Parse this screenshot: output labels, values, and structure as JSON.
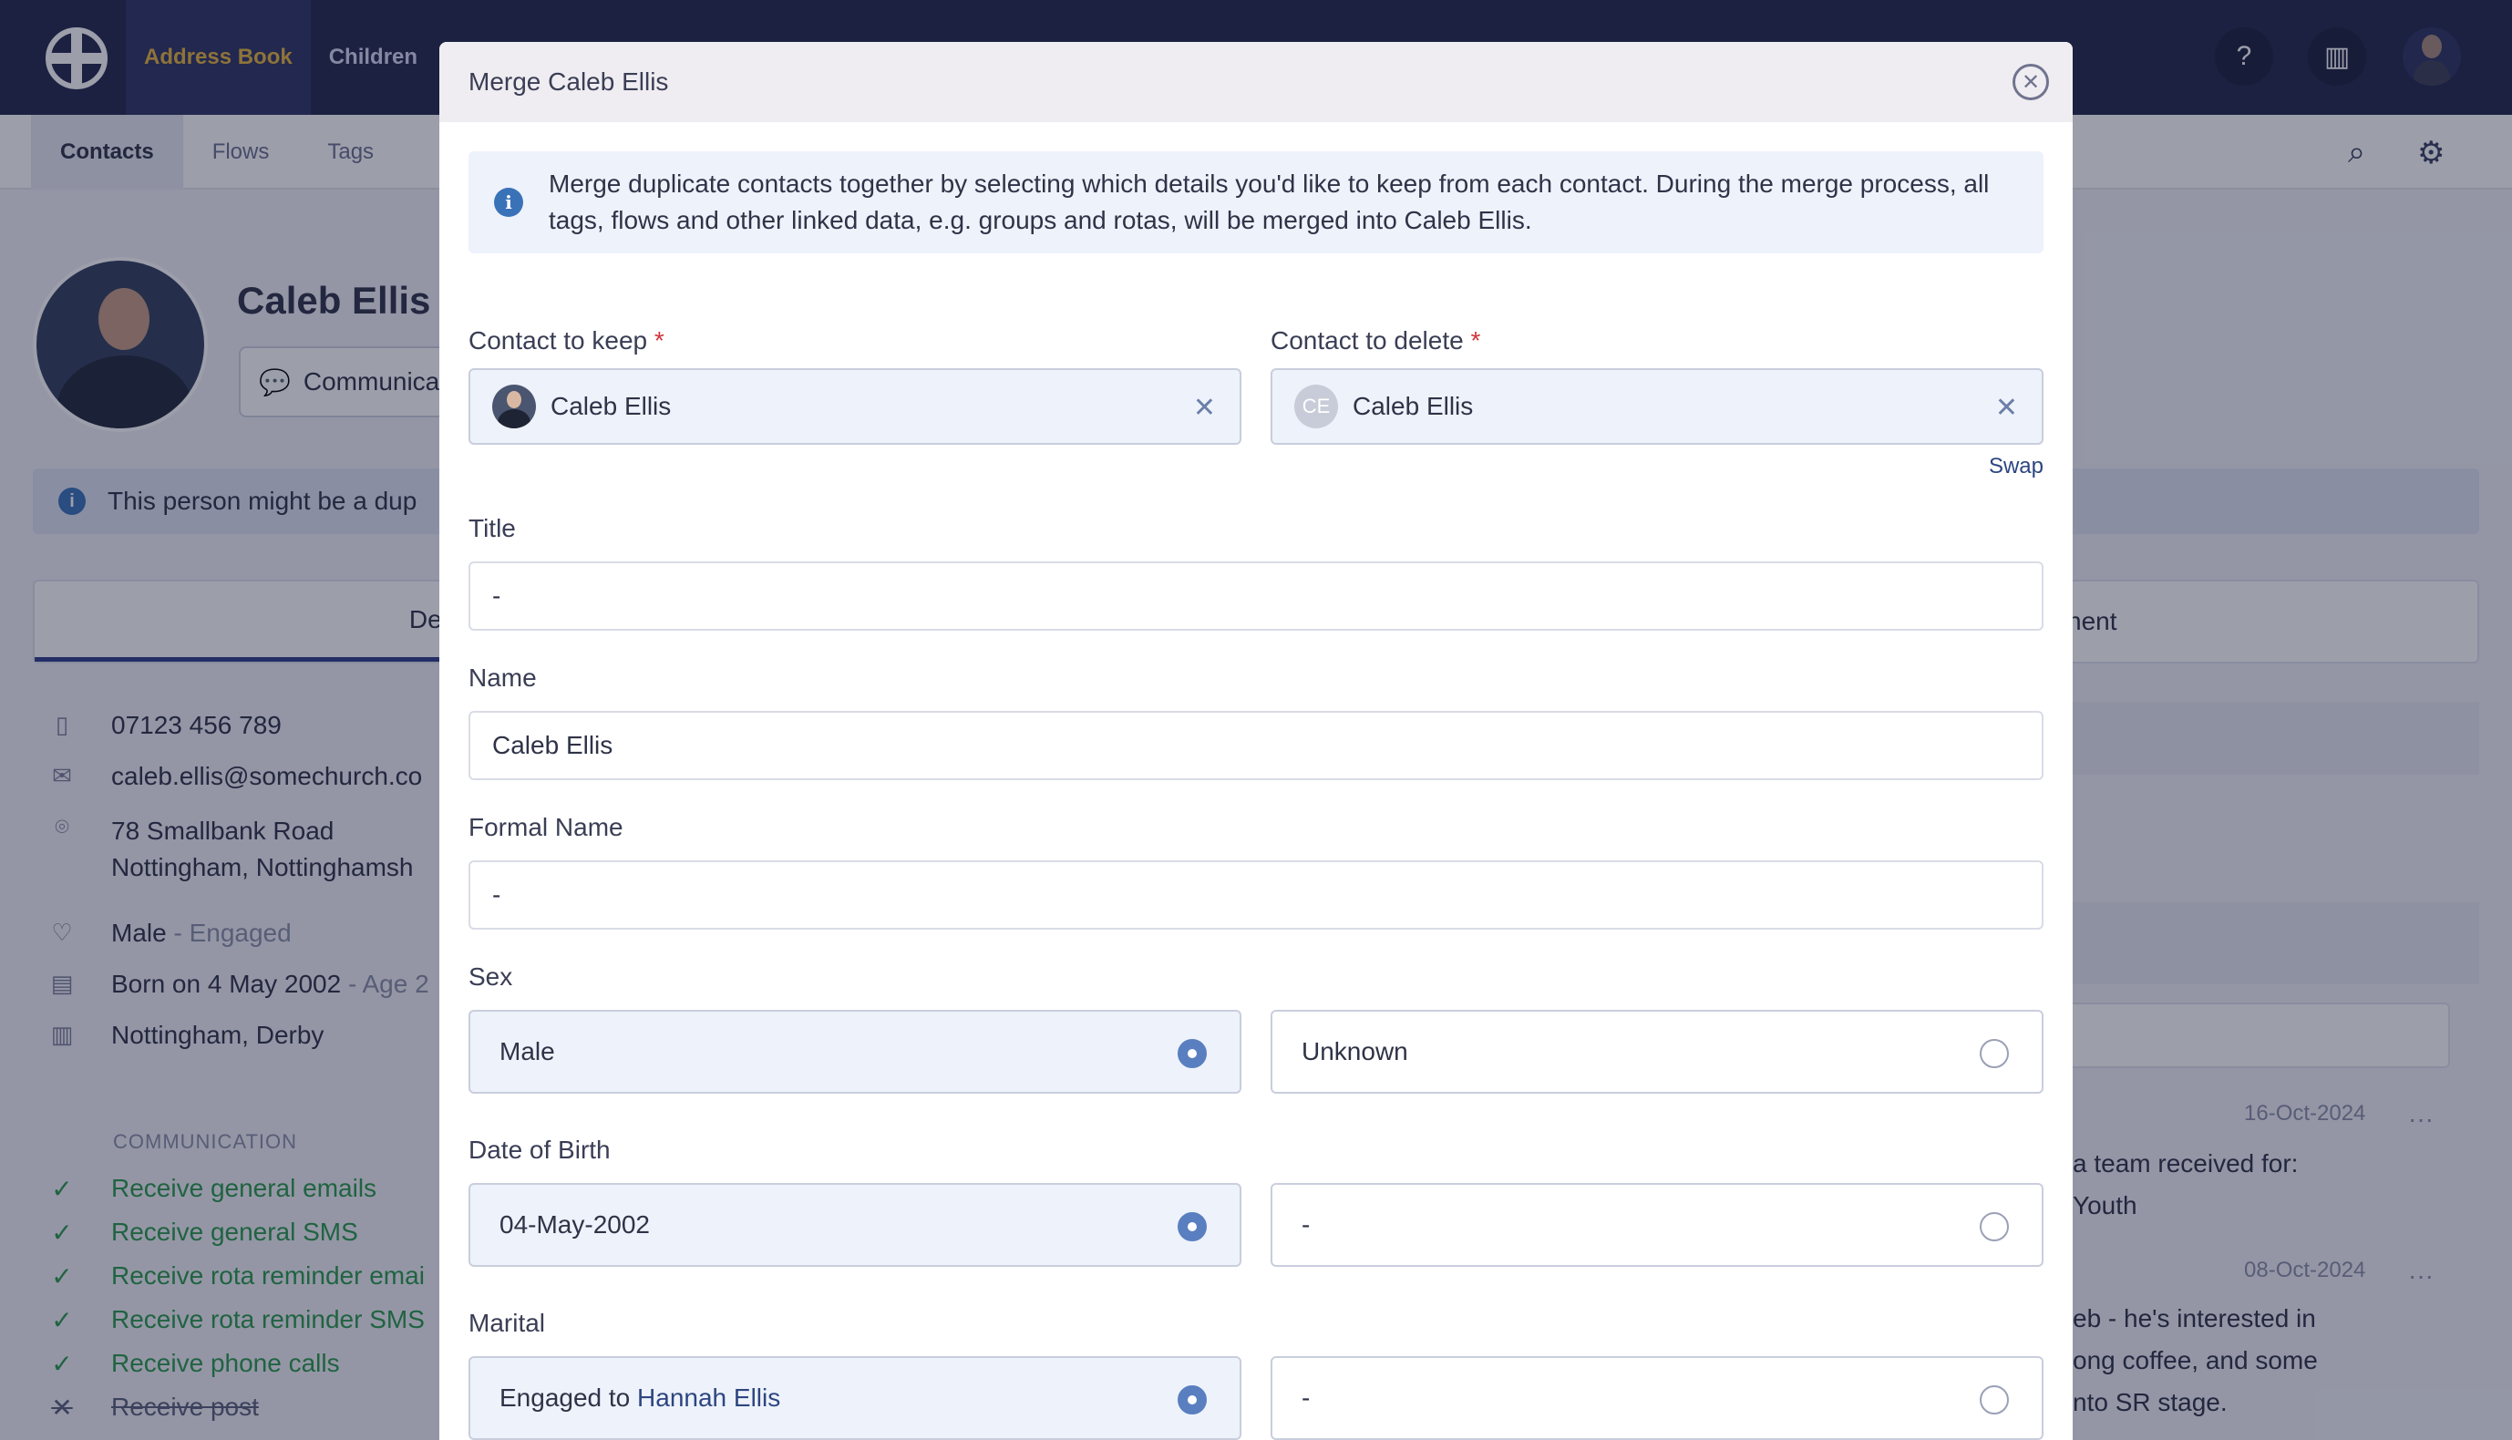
{
  "app": {
    "nav": [
      "Address Book",
      "Children"
    ],
    "subnav": [
      "Contacts",
      "Flows",
      "Tags"
    ],
    "help_icon": "question-circle-icon",
    "building_icon": "building-icon",
    "search_icon": "search-icon",
    "settings_icon": "cogs-icon"
  },
  "profile": {
    "name": "Caleb Ellis",
    "communicate_label": "Communica",
    "duplicate_alert": "This person might be a dup",
    "tab_details": "Deta",
    "tab_right": "nent",
    "phone": "07123 456 789",
    "email": "caleb.ellis@somechurch.co",
    "address_line1": "78 Smallbank Road",
    "address_line2": "Nottingham, Nottinghamsh",
    "sex": "Male",
    "marital_suffix": " - Engaged",
    "born": "Born on 4 May 2002",
    "age_suffix": " - Age 2",
    "location": "Nottingham, Derby",
    "communication_heading": "COMMUNICATION",
    "communication": [
      {
        "label": "Receive general emails",
        "enabled": true
      },
      {
        "label": "Receive general SMS",
        "enabled": true
      },
      {
        "label": "Receive rota reminder emai",
        "enabled": true
      },
      {
        "label": "Receive rota reminder SMS",
        "enabled": true
      },
      {
        "label": "Receive phone calls",
        "enabled": true
      },
      {
        "label": "Receive post",
        "enabled": false
      }
    ]
  },
  "feed": [
    {
      "date": "16-Oct-2024",
      "lines": [
        "a team received for:",
        "Youth"
      ]
    },
    {
      "date": "08-Oct-2024",
      "lines": [
        "eb - he's interested in",
        "ong coffee, and some",
        "nto SR stage."
      ]
    }
  ],
  "modal": {
    "title": "Merge Caleb Ellis",
    "info": "Merge duplicate contacts together by selecting which details you'd like to keep from each contact. During the merge process, all tags, flows and other linked data, e.g. groups and rotas, will be merged into Caleb Ellis.",
    "keep_label": "Contact to keep",
    "delete_label": "Contact to delete",
    "required_mark": "*",
    "keep_contact": "Caleb Ellis",
    "delete_contact": "Caleb Ellis",
    "delete_initials": "CE",
    "swap_label": "Swap",
    "title_label": "Title",
    "title_value": "-",
    "name_label": "Name",
    "name_value": "Caleb Ellis",
    "formal_name_label": "Formal Name",
    "formal_name_value": "-",
    "sex_label": "Sex",
    "sex_keep": "Male",
    "sex_delete": "Unknown",
    "dob_label": "Date of Birth",
    "dob_keep": "04-May-2002",
    "dob_delete": "-",
    "marital_label": "Marital",
    "marital_keep_prefix": "Engaged to ",
    "marital_keep_link": "Hannah Ellis",
    "marital_delete": "-",
    "selected_side": "keep"
  }
}
